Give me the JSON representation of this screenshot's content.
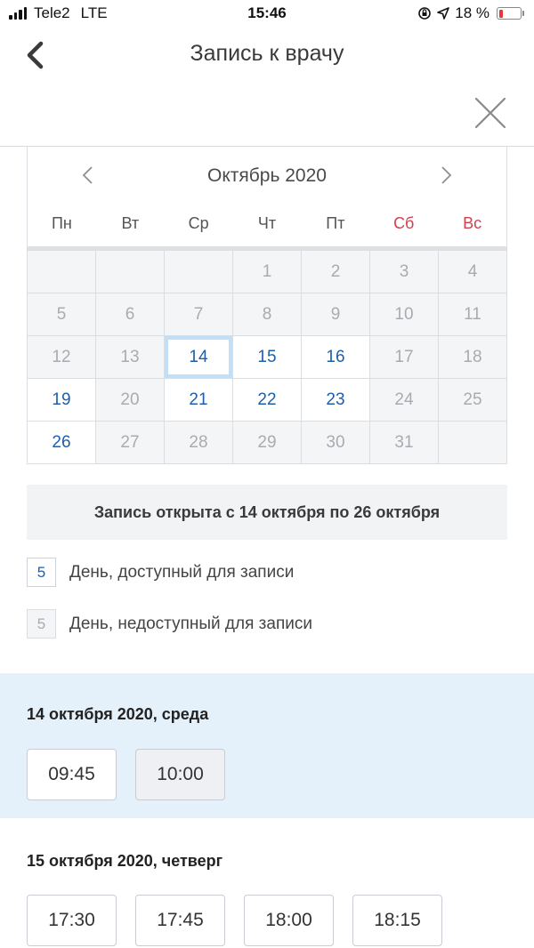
{
  "status_bar": {
    "carrier": "Tele2",
    "network": "LTE",
    "time": "15:46",
    "battery": "18 %",
    "battery_level": 0.18,
    "battery_color": "#e53935",
    "icons": [
      "signal-icon",
      "orientation-lock-icon",
      "location-arrow-icon",
      "battery-icon"
    ]
  },
  "header": {
    "title": "Запись к врачу",
    "back_icon": "chevron-left-icon",
    "close_icon": "close-icon"
  },
  "calendar": {
    "month_label": "Октябрь 2020",
    "weekdays": [
      "Пн",
      "Вт",
      "Ср",
      "Чт",
      "Пт",
      "Сб",
      "Вс"
    ],
    "weekend_color": "#d0414f",
    "available_color": "#1f5ea8",
    "weeks": [
      [
        {
          "d": "",
          "s": "empty"
        },
        {
          "d": "",
          "s": "empty"
        },
        {
          "d": "",
          "s": "empty"
        },
        {
          "d": "1",
          "s": "dis"
        },
        {
          "d": "2",
          "s": "dis"
        },
        {
          "d": "3",
          "s": "dis"
        },
        {
          "d": "4",
          "s": "dis"
        }
      ],
      [
        {
          "d": "5",
          "s": "dis"
        },
        {
          "d": "6",
          "s": "dis"
        },
        {
          "d": "7",
          "s": "dis"
        },
        {
          "d": "8",
          "s": "dis"
        },
        {
          "d": "9",
          "s": "dis"
        },
        {
          "d": "10",
          "s": "dis"
        },
        {
          "d": "11",
          "s": "dis"
        }
      ],
      [
        {
          "d": "12",
          "s": "dis"
        },
        {
          "d": "13",
          "s": "dis"
        },
        {
          "d": "14",
          "s": "sel"
        },
        {
          "d": "15",
          "s": "av"
        },
        {
          "d": "16",
          "s": "av"
        },
        {
          "d": "17",
          "s": "dis"
        },
        {
          "d": "18",
          "s": "dis"
        }
      ],
      [
        {
          "d": "19",
          "s": "av"
        },
        {
          "d": "20",
          "s": "dis"
        },
        {
          "d": "21",
          "s": "av"
        },
        {
          "d": "22",
          "s": "av"
        },
        {
          "d": "23",
          "s": "av"
        },
        {
          "d": "24",
          "s": "dis"
        },
        {
          "d": "25",
          "s": "dis"
        }
      ],
      [
        {
          "d": "26",
          "s": "av"
        },
        {
          "d": "27",
          "s": "dis"
        },
        {
          "d": "28",
          "s": "dis"
        },
        {
          "d": "29",
          "s": "dis"
        },
        {
          "d": "30",
          "s": "dis"
        },
        {
          "d": "31",
          "s": "dis"
        },
        {
          "d": "",
          "s": "empty"
        }
      ]
    ]
  },
  "notice": "Запись открыта с 14 октября по 26 октября",
  "legend": [
    {
      "sample": "5",
      "type": "av",
      "text": "День, доступный для записи"
    },
    {
      "sample": "5",
      "type": "dis",
      "text": "День, недоступный для записи"
    }
  ],
  "days": [
    {
      "title": "14 октября 2020, среда",
      "active": true,
      "slots": [
        "09:45",
        "10:00"
      ]
    },
    {
      "title": "15 октября 2020, четверг",
      "active": false,
      "slots": [
        "17:30",
        "17:45",
        "18:00",
        "18:15"
      ]
    }
  ]
}
